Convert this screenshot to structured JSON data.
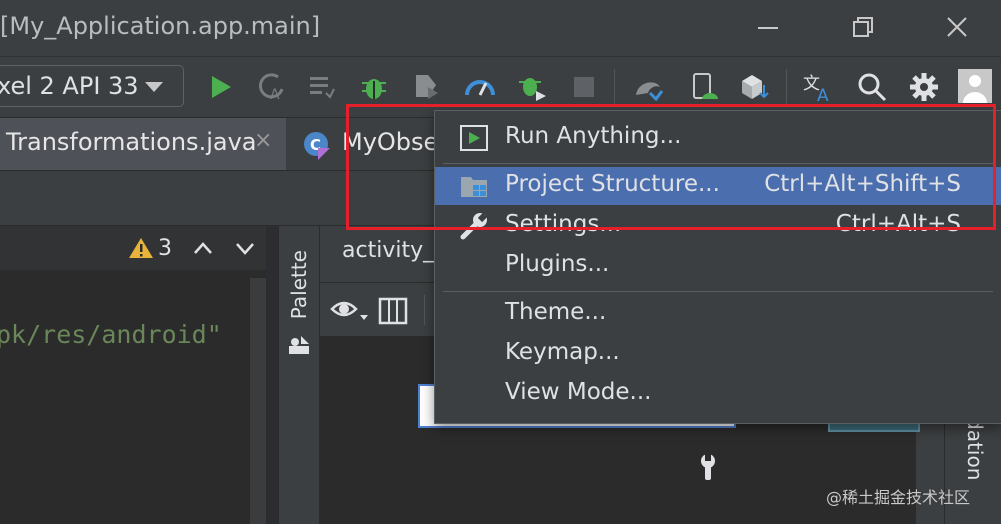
{
  "window": {
    "title": "[My_Application.app.main]"
  },
  "toolbar": {
    "device": "xel 2 API 33",
    "icons": [
      "run-icon",
      "apply-changes-icon",
      "apply-code-changes-icon",
      "debug-icon",
      "attach-debugger-icon",
      "profile-icon",
      "debug-attach-icon",
      "stop-icon",
      "sync-gradle-icon",
      "device-manager-icon",
      "sdk-manager-icon",
      "translate-icon",
      "search-icon",
      "settings-icon",
      "account-icon"
    ]
  },
  "tabs": [
    {
      "label": "Transformations.java",
      "close": "×"
    },
    {
      "label": "MyObse"
    }
  ],
  "editor": {
    "warning_count": "3",
    "code_line": "pk/res/android\""
  },
  "palette": {
    "label": "Palette"
  },
  "design": {
    "tab_label": "activity_",
    "side_label": "lidation"
  },
  "menu": {
    "items": [
      {
        "label": "Run Anything...",
        "shortcut": ""
      },
      {
        "label": "Project Structure...",
        "shortcut": "Ctrl+Alt+Shift+S",
        "selected": true
      },
      {
        "label": "Settings...",
        "shortcut": "Ctrl+Alt+S"
      },
      {
        "label": "Plugins...",
        "shortcut": ""
      },
      {
        "label": "Theme...",
        "shortcut": ""
      },
      {
        "label": "Keymap...",
        "shortcut": ""
      },
      {
        "label": "View Mode...",
        "shortcut": ""
      }
    ]
  },
  "watermark": "@稀土掘金技术社区",
  "colors": {
    "selection": "#4b6eaf",
    "highlight_box": "#e5202a",
    "run_green": "#4caf50"
  }
}
